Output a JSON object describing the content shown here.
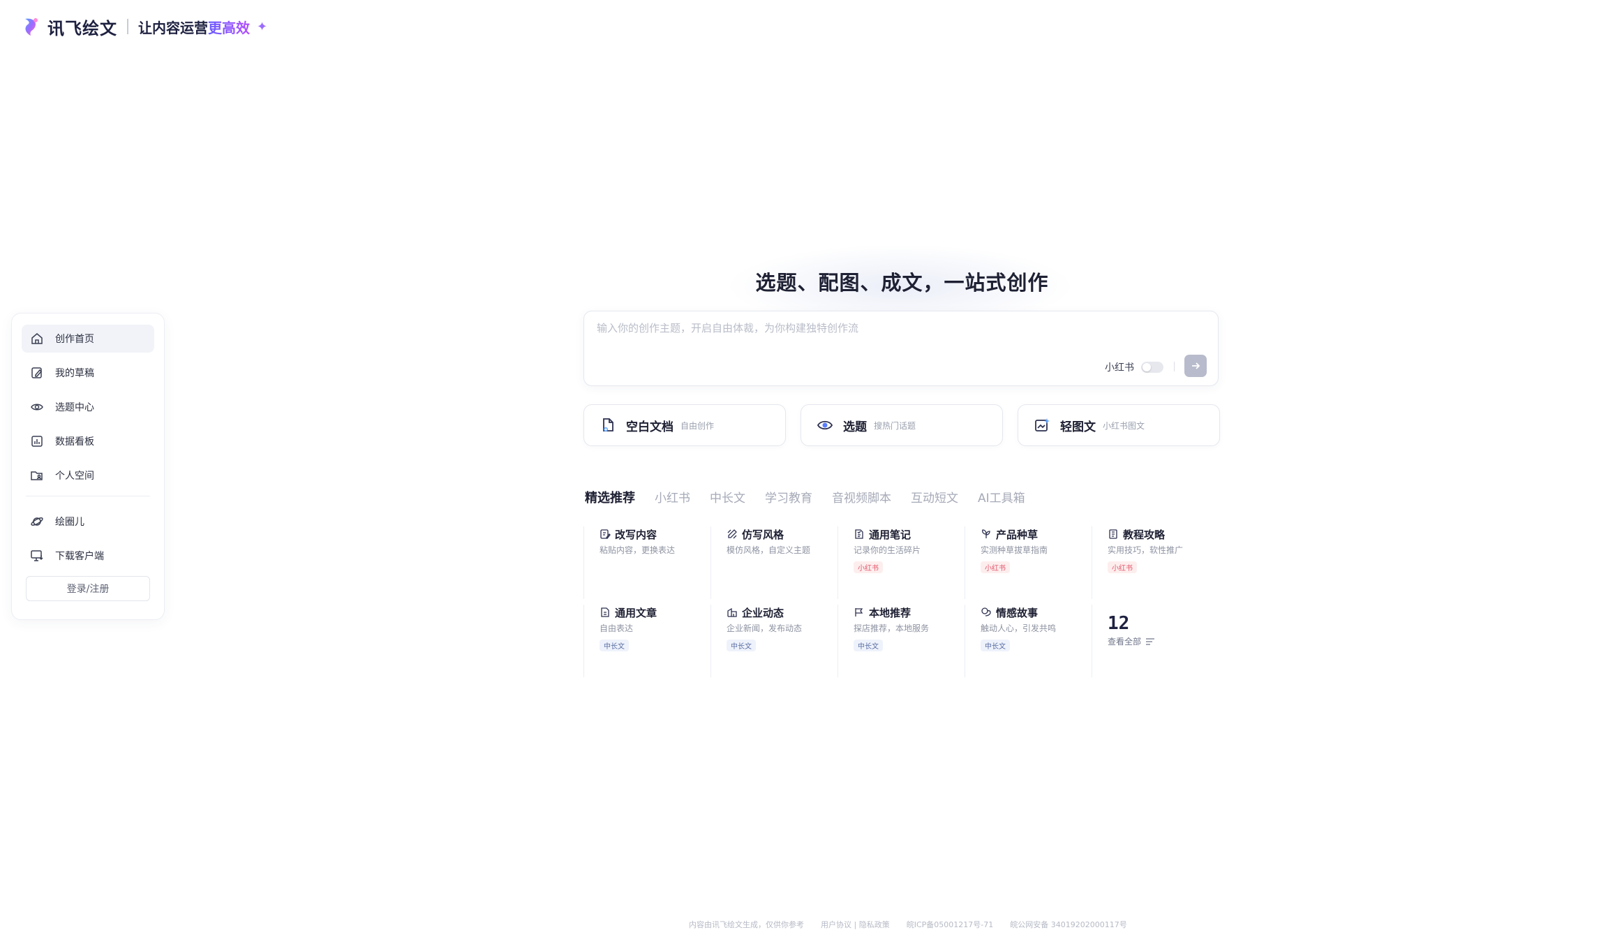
{
  "header": {
    "brand": "讯飞绘文",
    "slogan_prefix": "让内容运营",
    "slogan_highlight": "更高效",
    "sparkle": "✦"
  },
  "sidebar": {
    "items": [
      {
        "label": "创作首页",
        "icon": "home-icon",
        "active": true
      },
      {
        "label": "我的草稿",
        "icon": "edit-doc-icon"
      },
      {
        "label": "选题中心",
        "icon": "eye-icon"
      },
      {
        "label": "数据看板",
        "icon": "chart-icon"
      },
      {
        "label": "个人空间",
        "icon": "folder-user-icon"
      },
      {
        "label": "绘圈儿",
        "icon": "planet-icon"
      },
      {
        "label": "下载客户端",
        "icon": "monitor-download-icon"
      }
    ],
    "login_label": "登录/注册"
  },
  "hero": {
    "title": "选题、配图、成文，一站式创作",
    "input_placeholder": "输入你的创作主题，开启自由体裁，为你构建独特创作流",
    "xhs_toggle_label": "小红书",
    "send_icon": "arrow-right-icon"
  },
  "quick_actions": [
    {
      "title": "空白文档",
      "subtitle": "自由创作",
      "icon": "blank-doc-icon"
    },
    {
      "title": "选题",
      "subtitle": "搜热门话题",
      "icon": "eye-icon"
    },
    {
      "title": "轻图文",
      "subtitle": "小红书图文",
      "icon": "image-spark-icon"
    }
  ],
  "tabs": [
    "精选推荐",
    "小红书",
    "中长文",
    "学习教育",
    "音视频脚本",
    "互动短文",
    "AI工具箱"
  ],
  "templates": {
    "row1": [
      {
        "title": "改写内容",
        "desc": "粘贴内容，更换表达",
        "icon": "rewrite-icon",
        "tag": ""
      },
      {
        "title": "仿写风格",
        "desc": "模仿风格，自定义主题",
        "icon": "pen-style-icon",
        "tag": ""
      },
      {
        "title": "通用笔记",
        "desc": "记录你的生活碎片",
        "icon": "note-icon",
        "tag": "小红书",
        "tag_color": "red"
      },
      {
        "title": "产品种草",
        "desc": "实测种草拔草指南",
        "icon": "sprout-icon",
        "tag": "小红书",
        "tag_color": "red"
      },
      {
        "title": "教程攻略",
        "desc": "实用技巧，软性推广",
        "icon": "book-icon",
        "tag": "小红书",
        "tag_color": "red"
      }
    ],
    "row2": [
      {
        "title": "通用文章",
        "desc": "自由表达",
        "icon": "article-icon",
        "tag": "中长文",
        "tag_color": "blue"
      },
      {
        "title": "企业动态",
        "desc": "企业新闻，发布动态",
        "icon": "building-icon",
        "tag": "中长文",
        "tag_color": "blue"
      },
      {
        "title": "本地推荐",
        "desc": "探店推荐，本地服务",
        "icon": "flag-icon",
        "tag": "中长文",
        "tag_color": "blue"
      },
      {
        "title": "情感故事",
        "desc": "触动人心，引发共鸣",
        "icon": "heart-chat-icon",
        "tag": "中长文",
        "tag_color": "blue"
      }
    ],
    "more_count": "12",
    "more_label": "查看全部"
  },
  "footer": {
    "disclaimer": "内容由讯飞绘文生成，仅供你参考",
    "links": "用户协议 | 隐私政策",
    "icp": "皖ICP备05001217号-71",
    "police": "皖公网安备 34019202000117号"
  }
}
